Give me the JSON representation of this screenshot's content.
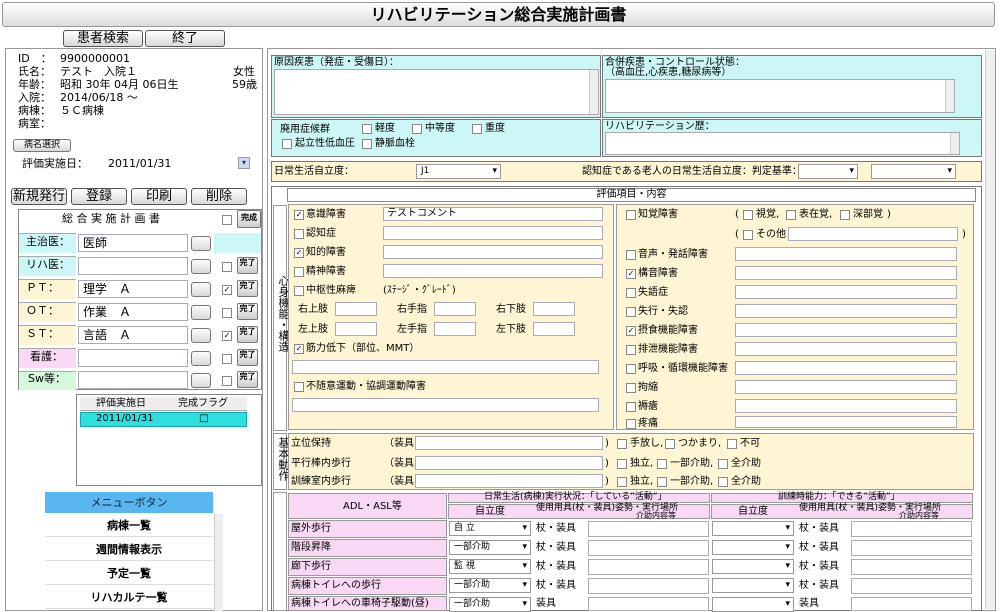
{
  "window": {
    "title": "リハビリテーション総合実施計画書"
  },
  "top_buttons": {
    "patient_search": "患者検索",
    "exit": "終了"
  },
  "patient": {
    "id_label": "ID　：",
    "id_value": "9900000001",
    "name_label": "氏名：",
    "name_value": "テスト　入院１",
    "sex": "女性",
    "birth_label": "年齢：",
    "birth_value": "昭和 30年 04月 06日生",
    "age": "59歳",
    "admit_label": "入院：",
    "admit_value": "2014/06/18 ～",
    "ward_label": "病棟：",
    "ward_value": "５Ｃ病棟",
    "room_label": "病室："
  },
  "disease_select_btn": "病名選択",
  "eval_date_label": "評価実施日：",
  "eval_date_value": "2011/01/31",
  "action_buttons": {
    "new": "新規発行",
    "register": "登録",
    "print": "印刷",
    "delete": "削除"
  },
  "plan": {
    "header": "総 合 実 施 計 画 書",
    "complete_label": "完成",
    "done_label": "完了",
    "rows": [
      {
        "label": "主治医：",
        "value": "医師"
      },
      {
        "label": "リハ医：",
        "value": ""
      },
      {
        "label": "ＰＴ：",
        "value": "理学　Ａ"
      },
      {
        "label": "ＯＴ：",
        "value": "作業　Ａ"
      },
      {
        "label": "ＳＴ：",
        "value": "言語　Ａ"
      },
      {
        "label": "看護：",
        "value": ""
      },
      {
        "label": "Sw等：",
        "value": ""
      }
    ]
  },
  "eval_list": {
    "col1": "評価実施日",
    "col2": "完成フラグ",
    "row_date": "2011/01/31",
    "row_flag": "□"
  },
  "menu": {
    "header": "メニューボタン",
    "items": [
      "病棟一覧",
      "週間情報表示",
      "予定一覧",
      "リハカルテ一覧"
    ]
  },
  "right": {
    "cause_label": "原因疾患（発症・受傷日）：",
    "comorbid_label": "合併疾患・コントロール状態：",
    "comorbid_sub": "（高血圧,心疾患,糖尿病等）",
    "disuse_label": "廃用症候群",
    "disuse_opts": [
      "軽度",
      "中等度",
      "重度"
    ],
    "disuse_opts2": [
      "起立性低血圧",
      "静脈血栓"
    ],
    "rehab_history_label": "リハビリテーション歴：",
    "daily_label": "日常生活自立度：",
    "daily_value": "J1",
    "dementia_label": "認知症である老人の日常生活自立度：判定基準：",
    "eval_header": "評価項目・内容",
    "side_label1": "心身機能・構造",
    "left_items": [
      {
        "label": "意識障害",
        "checked": true,
        "text": "テストコメント"
      },
      {
        "label": "認知症",
        "checked": false,
        "text": ""
      },
      {
        "label": "知的障害",
        "checked": true,
        "text": ""
      },
      {
        "label": "精神障害",
        "checked": false,
        "text": ""
      },
      {
        "label": "中枢性麻痺",
        "checked": false,
        "text": "(ｽﾃｰｼﾞ・ｸﾞﾚｰﾄﾞ)"
      }
    ],
    "limbs": [
      "右上肢",
      "右手指",
      "右下肢",
      "左上肢",
      "左手指",
      "左下肢"
    ],
    "muscle": "筋力低下（部位、MMT）",
    "involuntary": "不随意運動・協調運動障害",
    "right_items": [
      {
        "label": "知覚障害",
        "checked": false
      },
      {
        "label": "音声・発話障害",
        "checked": false
      },
      {
        "label": "構音障害",
        "checked": true
      },
      {
        "label": "失語症",
        "checked": false
      },
      {
        "label": "失行・失認",
        "checked": false
      },
      {
        "label": "摂食機能障害",
        "checked": true
      },
      {
        "label": "排泄機能障害",
        "checked": false
      },
      {
        "label": "呼吸・循環機能障害",
        "checked": false
      },
      {
        "label": "拘縮",
        "checked": false
      },
      {
        "label": "褥瘡",
        "checked": false
      },
      {
        "label": "疼痛",
        "checked": false
      }
    ],
    "sense_opts": [
      "視覚,",
      "表在覚,",
      "深部覚"
    ],
    "sense_other": "その他",
    "side_label2": "基本動作",
    "basic": [
      {
        "label": "立位保持",
        "tool": "（装具",
        "opts": [
          "手放し,",
          "つかまり,",
          "不可"
        ]
      },
      {
        "label": "平行棒内歩行",
        "tool": "（装具",
        "opts": [
          "独立,",
          "一部介助,",
          "全介助"
        ]
      },
      {
        "label": "訓練室内歩行",
        "tool": "（装具",
        "opts": [
          "独立,",
          "一部介助,",
          "全介助"
        ]
      }
    ],
    "adl_header": "ADL・ASL等",
    "adl_daily_header": "日常生活(病棟)実行状況：「している”活動”」",
    "adl_train_header": "訓練時能力：「できる”活動”」",
    "adl_col_indep": "自立度",
    "adl_col_tool": "使用用具(杖・装具)",
    "adl_col_place": "姿勢・実行場所",
    "adl_col_note": "介助内容等",
    "adl_rows": [
      {
        "label": "屋外歩行",
        "value": "自 立",
        "tool": "杖・装具"
      },
      {
        "label": "階段昇降",
        "value": "一部介助",
        "tool": "杖・装具"
      },
      {
        "label": "廊下歩行",
        "value": "監 視",
        "tool": "杖・装具"
      },
      {
        "label": "病棟トイレへの歩行",
        "value": "一部介助",
        "tool": "杖・装具"
      },
      {
        "label": "病棟トイレへの車椅子駆動(昼)",
        "value": "一部介助",
        "tool": "装具"
      }
    ]
  }
}
